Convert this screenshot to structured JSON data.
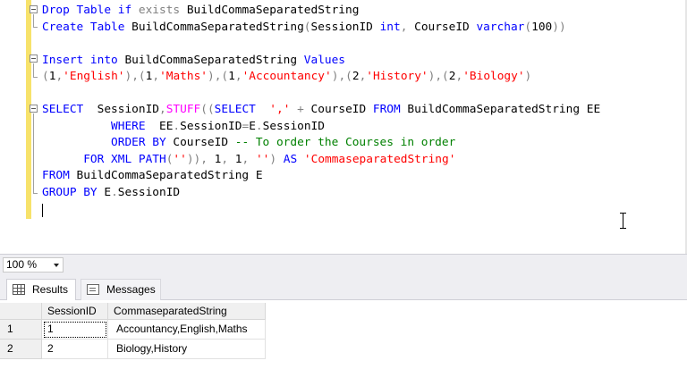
{
  "editor": {
    "lines": [
      [
        {
          "t": "Drop Table if ",
          "c": "kw"
        },
        {
          "t": "exists ",
          "c": "gr"
        },
        {
          "t": "BuildCommaSeparatedString",
          "c": ""
        }
      ],
      [
        {
          "t": "Create Table ",
          "c": "kw"
        },
        {
          "t": "BuildCommaSeparatedString",
          "c": ""
        },
        {
          "t": "(",
          "c": "gr"
        },
        {
          "t": "SessionID ",
          "c": ""
        },
        {
          "t": "int",
          "c": "kw"
        },
        {
          "t": ", ",
          "c": "gr"
        },
        {
          "t": "CourseID ",
          "c": ""
        },
        {
          "t": "varchar",
          "c": "kw"
        },
        {
          "t": "(",
          "c": "gr"
        },
        {
          "t": "100",
          "c": ""
        },
        {
          "t": "))",
          "c": "gr"
        }
      ],
      [],
      [
        {
          "t": "Insert into ",
          "c": "kw"
        },
        {
          "t": "BuildCommaSeparatedString ",
          "c": ""
        },
        {
          "t": "Values",
          "c": "kw"
        }
      ],
      [
        {
          "t": "(",
          "c": "gr"
        },
        {
          "t": "1",
          "c": ""
        },
        {
          "t": ",",
          "c": "gr"
        },
        {
          "t": "'English'",
          "c": "str"
        },
        {
          "t": "),(",
          "c": "gr"
        },
        {
          "t": "1",
          "c": ""
        },
        {
          "t": ",",
          "c": "gr"
        },
        {
          "t": "'Maths'",
          "c": "str"
        },
        {
          "t": "),(",
          "c": "gr"
        },
        {
          "t": "1",
          "c": ""
        },
        {
          "t": ",",
          "c": "gr"
        },
        {
          "t": "'Accountancy'",
          "c": "str"
        },
        {
          "t": "),(",
          "c": "gr"
        },
        {
          "t": "2",
          "c": ""
        },
        {
          "t": ",",
          "c": "gr"
        },
        {
          "t": "'History'",
          "c": "str"
        },
        {
          "t": "),(",
          "c": "gr"
        },
        {
          "t": "2",
          "c": ""
        },
        {
          "t": ",",
          "c": "gr"
        },
        {
          "t": "'Biology'",
          "c": "str"
        },
        {
          "t": ")",
          "c": "gr"
        }
      ],
      [],
      [
        {
          "t": "SELECT  ",
          "c": "kw"
        },
        {
          "t": "SessionID",
          "c": ""
        },
        {
          "t": ",",
          "c": "gr"
        },
        {
          "t": "STUFF",
          "c": "fn"
        },
        {
          "t": "((",
          "c": "gr"
        },
        {
          "t": "SELECT  ",
          "c": "kw"
        },
        {
          "t": "','",
          "c": "str"
        },
        {
          "t": " + ",
          "c": "gr"
        },
        {
          "t": "CourseID ",
          "c": ""
        },
        {
          "t": "FROM ",
          "c": "kw"
        },
        {
          "t": "BuildCommaSeparatedString EE",
          "c": ""
        }
      ],
      [
        {
          "t": "          WHERE  ",
          "c": "kw"
        },
        {
          "t": "EE",
          "c": ""
        },
        {
          "t": ".",
          "c": "gr"
        },
        {
          "t": "SessionID",
          "c": ""
        },
        {
          "t": "=",
          "c": "gr"
        },
        {
          "t": "E",
          "c": ""
        },
        {
          "t": ".",
          "c": "gr"
        },
        {
          "t": "SessionID",
          "c": ""
        }
      ],
      [
        {
          "t": "          ORDER BY ",
          "c": "kw"
        },
        {
          "t": "CourseID ",
          "c": ""
        },
        {
          "t": "-- To order the Courses in order",
          "c": "cm"
        }
      ],
      [
        {
          "t": "      FOR XML PATH",
          "c": "kw"
        },
        {
          "t": "(",
          "c": "gr"
        },
        {
          "t": "''",
          "c": "str"
        },
        {
          "t": ")), ",
          "c": "gr"
        },
        {
          "t": "1",
          "c": ""
        },
        {
          "t": ", ",
          "c": "gr"
        },
        {
          "t": "1",
          "c": ""
        },
        {
          "t": ", ",
          "c": "gr"
        },
        {
          "t": "''",
          "c": "str"
        },
        {
          "t": ") ",
          "c": "gr"
        },
        {
          "t": "AS ",
          "c": "kw"
        },
        {
          "t": "'CommaseparatedString'",
          "c": "str"
        }
      ],
      [
        {
          "t": "FROM ",
          "c": "kw"
        },
        {
          "t": "BuildCommaSeparatedString E",
          "c": ""
        }
      ],
      [
        {
          "t": "GROUP BY ",
          "c": "kw"
        },
        {
          "t": "E",
          "c": ""
        },
        {
          "t": ".",
          "c": "gr"
        },
        {
          "t": "SessionID",
          "c": ""
        }
      ],
      []
    ]
  },
  "zoom": {
    "value": "100 %"
  },
  "tabs": [
    {
      "label": "Results",
      "icon": "grid-icon"
    },
    {
      "label": "Messages",
      "icon": "messages-icon"
    }
  ],
  "results": {
    "columns": [
      "SessionID",
      "CommaseparatedString"
    ],
    "rows": [
      {
        "num": "1",
        "cells": [
          "1",
          "Accountancy,English,Maths"
        ]
      },
      {
        "num": "2",
        "cells": [
          "2",
          "Biology,History"
        ]
      }
    ]
  },
  "colors": {
    "keyword": "#0000ff",
    "function": "#ff00ff",
    "string": "#ff0000",
    "comment": "#008000",
    "margin": "#f7e26b"
  }
}
